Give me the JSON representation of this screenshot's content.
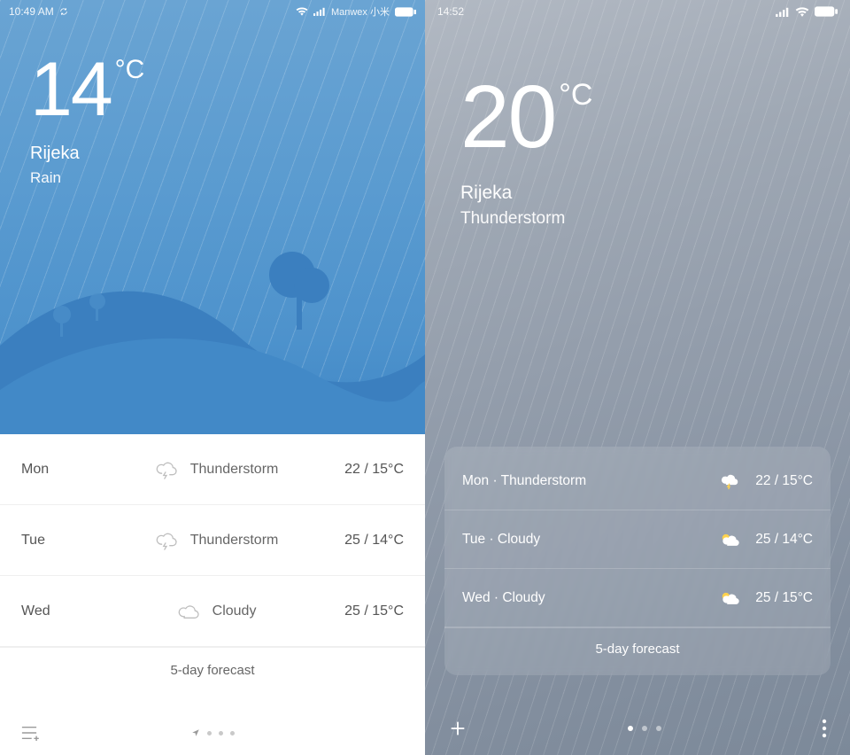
{
  "left": {
    "status": {
      "time": "10:49 AM",
      "carrier": "Manwex  小米"
    },
    "temp": "14",
    "unit": "°C",
    "location": "Rijeka",
    "condition": "Rain",
    "forecast": [
      {
        "day": "Mon",
        "cond": "Thunderstorm",
        "range": "22 / 15°C"
      },
      {
        "day": "Tue",
        "cond": "Thunderstorm",
        "range": "25 / 14°C"
      },
      {
        "day": "Wed",
        "cond": "Cloudy",
        "range": "25 / 15°C"
      }
    ],
    "forecast_link": "5-day forecast"
  },
  "right": {
    "status": {
      "time": "14:52"
    },
    "temp": "20",
    "unit": "°C",
    "location": "Rijeka",
    "condition": "Thunderstorm",
    "forecast": [
      {
        "line": "Mon · Thunderstorm",
        "range": "22 / 15°C"
      },
      {
        "line": "Tue · Cloudy",
        "range": "25 / 14°C"
      },
      {
        "line": "Wed · Cloudy",
        "range": "25 / 15°C"
      }
    ],
    "forecast_link": "5-day forecast"
  }
}
